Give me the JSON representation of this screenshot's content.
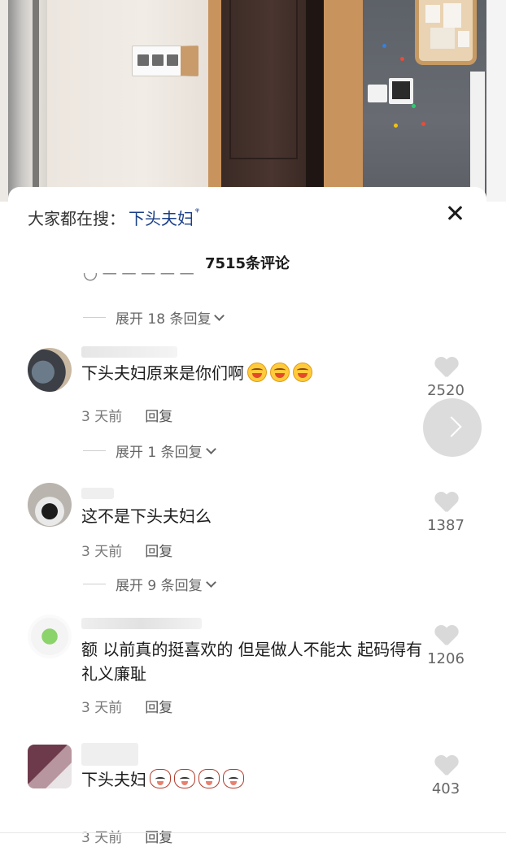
{
  "sheet": {
    "search_label": "大家都在搜：",
    "search_term": "下头夫妇",
    "search_icon_glyph": "ᵠ",
    "comment_count_title": "7515条评论"
  },
  "expands": [
    {
      "label": "展开 18 条回复"
    },
    {
      "label": "展开 1 条回复"
    },
    {
      "label": "展开 9 条回复"
    }
  ],
  "comments": [
    {
      "text": "下头夫妇原来是你们啊",
      "time": "3 天前",
      "reply": "回复",
      "likes": "2520",
      "emoji": [
        "laugh-emoji",
        "laugh-emoji",
        "laugh-emoji"
      ]
    },
    {
      "text": "这不是下头夫妇么",
      "time": "3 天前",
      "reply": "回复",
      "likes": "1387"
    },
    {
      "text": "额 以前真的挺喜欢的 但是做人不能太 起码得有礼义廉耻",
      "time": "3 天前",
      "reply": "回复",
      "likes": "1206"
    },
    {
      "text": "下头夫妇",
      "time": "3 天前",
      "reply": "回复",
      "likes": "403",
      "emoji": [
        "cat-emoji",
        "cat-emoji",
        "cat-emoji",
        "cat-emoji"
      ]
    }
  ],
  "colors": {
    "search_term": "#1a3f87",
    "secondary_text": "#777777",
    "heart": "#d9d9d9"
  }
}
